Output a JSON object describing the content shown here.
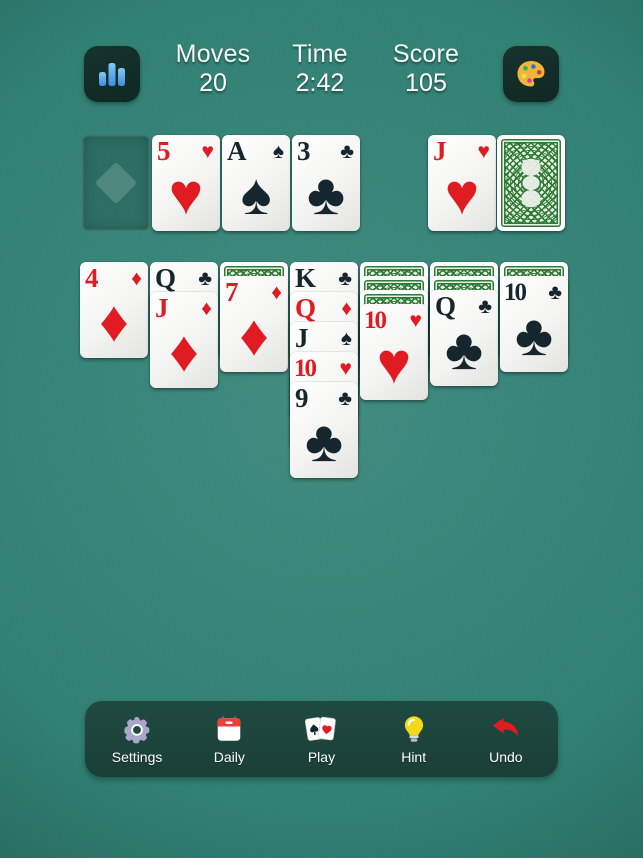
{
  "topbar": {
    "stats_icon": "bar-chart-icon",
    "theme_icon": "palette-icon",
    "stats": [
      {
        "label": "Moves",
        "value": "20"
      },
      {
        "label": "Time",
        "value": "2:42"
      },
      {
        "label": "Score",
        "value": "105"
      }
    ]
  },
  "foundations": [
    {
      "state": "empty",
      "pip": "diamond-slot-icon"
    },
    {
      "state": "card",
      "rank": "5",
      "suit": "♥",
      "color": "red"
    },
    {
      "state": "card",
      "rank": "A",
      "suit": "♠",
      "color": "black"
    },
    {
      "state": "card",
      "rank": "3",
      "suit": "♣",
      "color": "black"
    }
  ],
  "waste": {
    "rank": "J",
    "suit": "♥",
    "color": "red"
  },
  "stock": {
    "state": "face-down"
  },
  "tableau": [
    {
      "facedown": 0,
      "faceup": [
        {
          "rank": "4",
          "suit": "♦",
          "color": "red"
        }
      ]
    },
    {
      "facedown": 0,
      "faceup": [
        {
          "rank": "Q",
          "suit": "♣",
          "color": "black"
        },
        {
          "rank": "J",
          "suit": "♦",
          "color": "red"
        }
      ]
    },
    {
      "facedown": 1,
      "faceup": [
        {
          "rank": "7",
          "suit": "♦",
          "color": "red"
        }
      ]
    },
    {
      "facedown": 0,
      "faceup": [
        {
          "rank": "K",
          "suit": "♣",
          "color": "black"
        },
        {
          "rank": "Q",
          "suit": "♦",
          "color": "red"
        },
        {
          "rank": "J",
          "suit": "♠",
          "color": "black"
        },
        {
          "rank": "10",
          "suit": "♥",
          "color": "red"
        },
        {
          "rank": "9",
          "suit": "♣",
          "color": "black"
        }
      ]
    },
    {
      "facedown": 3,
      "faceup": [
        {
          "rank": "10",
          "suit": "♥",
          "color": "red"
        }
      ]
    },
    {
      "facedown": 2,
      "faceup": [
        {
          "rank": "Q",
          "suit": "♣",
          "color": "black"
        }
      ]
    },
    {
      "facedown": 1,
      "faceup": [
        {
          "rank": "10",
          "suit": "♣",
          "color": "black"
        }
      ]
    }
  ],
  "toolbar": [
    {
      "label": "Settings",
      "icon": "gear-icon"
    },
    {
      "label": "Daily",
      "icon": "calendar-icon"
    },
    {
      "label": "Play",
      "icon": "cards-icon"
    },
    {
      "label": "Hint",
      "icon": "lightbulb-icon"
    },
    {
      "label": "Undo",
      "icon": "undo-arrow-icon"
    }
  ],
  "colors": {
    "felt": "#2f8174",
    "red_suit": "#e01b22",
    "black_suit": "#16262e",
    "toolbar_bg": "#1f4a41",
    "card_back_green": "#2f7a36"
  }
}
